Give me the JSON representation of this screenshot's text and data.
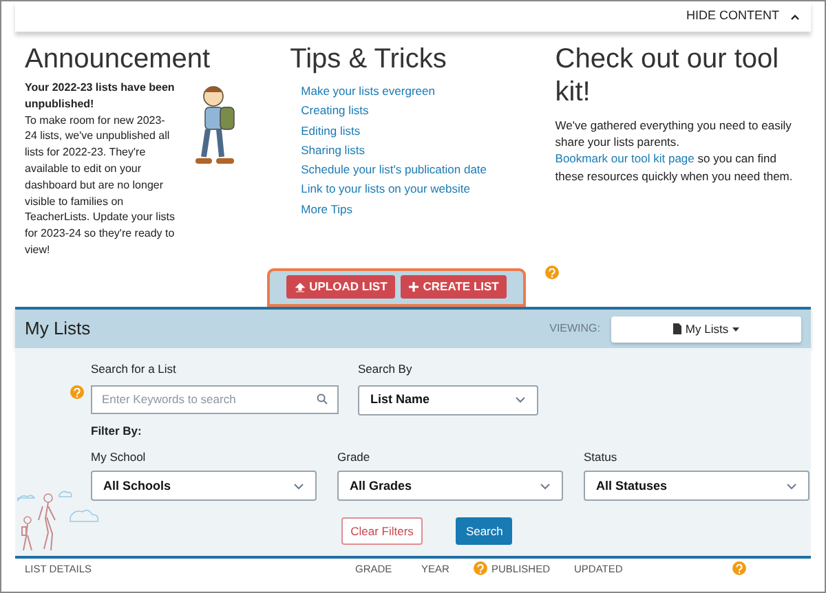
{
  "top_bar": {
    "toggle_label": "HIDE CONTENT"
  },
  "announcement": {
    "title": "Announcement",
    "lead": "Your 2022-23 lists have been unpublished!",
    "body": "To make room for new 2023-24 lists, we've unpublished all lists for 2022-23. They're available to edit on your dashboard but are no longer visible to families on TeacherLists. Update your lists for 2023-24 so they're ready to view!"
  },
  "tips": {
    "title": "Tips & Tricks",
    "links": [
      "Make your lists evergreen",
      "Creating lists",
      "Editing lists",
      "Sharing lists",
      "Schedule your list's publication date",
      "Link to your lists on your website",
      "More Tips"
    ]
  },
  "toolkit": {
    "title": "Check out our tool kit!",
    "text_before": "We've gathered everything you need to easily share your lists parents.",
    "link": "Bookmark our tool kit page",
    "text_after": "so you can find these resources quickly when you need them."
  },
  "actions": [
    {
      "kind": "upload",
      "label": "UPLOAD LIST"
    },
    {
      "kind": "create",
      "label": "CREATE LIST"
    }
  ],
  "my_lists": {
    "title": "My Lists",
    "viewing_label": "VIEWING:",
    "viewing_value": "My Lists"
  },
  "search": {
    "label": "Search for a List",
    "placeholder": "Enter Keywords to search",
    "by_label": "Search By",
    "by_value": "List Name"
  },
  "filters": {
    "title": "Filter By:",
    "fields": [
      {
        "label": "My School",
        "value": "All Schools"
      },
      {
        "label": "Grade",
        "value": "All Grades"
      },
      {
        "label": "Status",
        "value": "All Statuses"
      }
    ]
  },
  "buttons": {
    "clear": "Clear Filters",
    "search": "Search"
  },
  "table": {
    "columns": [
      "LIST DETAILS",
      "GRADE",
      "YEAR",
      "PUBLISHED",
      "UPDATED"
    ]
  }
}
